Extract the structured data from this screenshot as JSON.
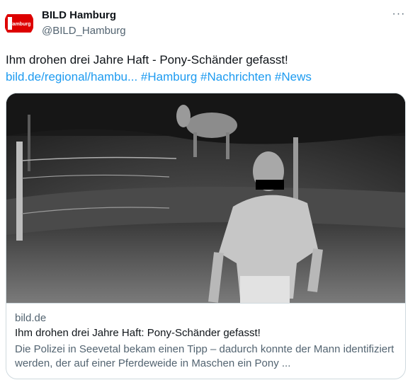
{
  "author": {
    "name": "BILD Hamburg",
    "handle": "@BILD_Hamburg",
    "avatar_text": "Hamburg",
    "avatar_color": "#dd0000"
  },
  "more_label": "···",
  "tweet_text": "Ihm drohen drei Jahre Haft - Pony-Schänder gefasst!",
  "link_text": "bild.de/regional/hambu...",
  "hashtags": [
    "#Hamburg",
    "#Nachrichten",
    "#News"
  ],
  "card": {
    "domain": "bild.de",
    "title": "Ihm drohen drei Jahre Haft: Pony-Schänder gefasst!",
    "description": "Die Polizei in Seevetal bekam einen Tipp – dadurch konnte der Mann identifiziert werden, der auf einer Pferdeweide in Maschen ein Pony ..."
  },
  "colors": {
    "link": "#1d9bf0",
    "text": "#0f1419",
    "muted": "#536471",
    "border": "#cfd9de"
  }
}
